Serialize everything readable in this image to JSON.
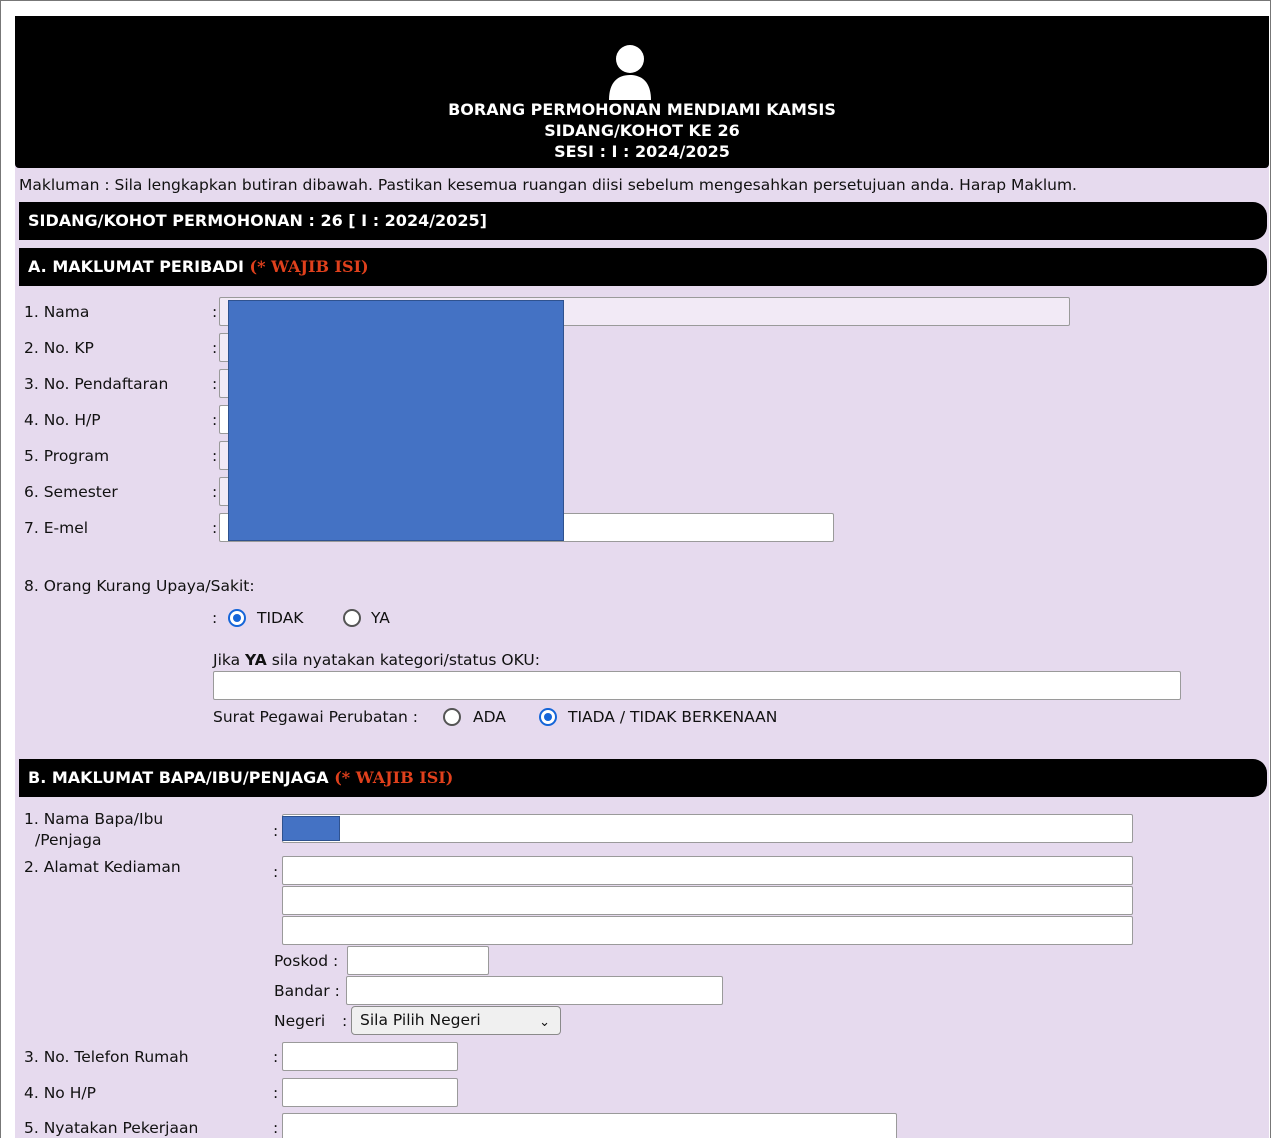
{
  "header": {
    "title_line1": "BORANG PERMOHONAN MENDIAMI KAMSIS",
    "title_line2": "SIDANG/KOHOT KE 26",
    "title_line3": "SESI : I : 2024/2025"
  },
  "notice": "Makluman : Sila lengkapkan butiran dibawah. Pastikan kesemua ruangan diisi sebelum mengesahkan persetujuan anda. Harap Maklum.",
  "session_bar": "SIDANG/KOHOT PERMOHONAN : 26 [ I : 2024/2025]",
  "section_a": {
    "title": "A. MAKLUMAT PERIBADI ",
    "required": "(* WAJIB ISI)",
    "fields": {
      "nama": "1. Nama",
      "no_kp": "2. No. KP",
      "no_pendaftaran": "3. No. Pendaftaran",
      "no_hp": "4. No. H/P",
      "program": "5. Program",
      "semester": "6. Semester",
      "emel": "7. E-mel"
    },
    "oku_label": "8. Orang Kurang Upaya/Sakit:",
    "oku_tidak": "TIDAK",
    "oku_ya": "YA",
    "oku_detail_prefix": "Jika ",
    "oku_detail_bold": "YA",
    "oku_detail_suffix": " sila nyatakan kategori/status OKU:",
    "surat_label": "Surat Pegawai Perubatan :",
    "surat_ada": "ADA",
    "surat_tiada": "TIADA / TIDAK BERKENAAN"
  },
  "section_b": {
    "title": "B. MAKLUMAT BAPA/IBU/PENJAGA ",
    "required": "(* WAJIB ISI)",
    "nama_line1": "1. Nama Bapa/Ibu",
    "nama_line2": "/Penjaga",
    "alamat": "2. Alamat Kediaman",
    "poskod": "Poskod :",
    "bandar": "Bandar :",
    "negeri": "Negeri",
    "negeri_select": "Sila Pilih Negeri",
    "tel_rumah": "3. No. Telefon Rumah",
    "no_hp": "4. No H/P",
    "pekerjaan": "5. Nyatakan Pekerjaan"
  },
  "colon": ":",
  "colors": {
    "header_bg": "#000000",
    "form_bg": "#e6daee",
    "required": "#e0401c",
    "radio_selected": "#1565d8",
    "redaction": "#4472c4"
  },
  "icons": {
    "header": "user-icon",
    "select": "chevron-down-icon"
  }
}
